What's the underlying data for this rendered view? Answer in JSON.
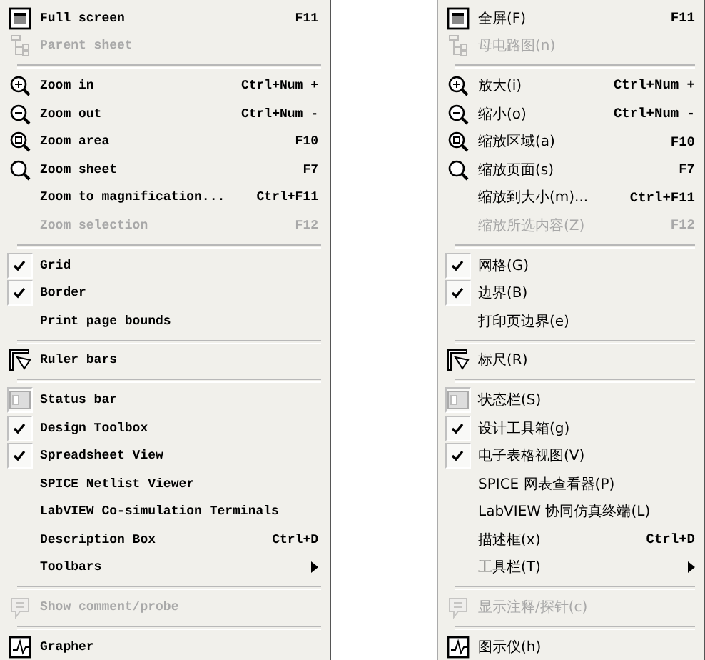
{
  "menus": [
    {
      "items": [
        {
          "kind": "item",
          "label": "Full screen",
          "shortcut": "F11",
          "checked": false,
          "disabled": false,
          "submenu": false
        },
        {
          "kind": "item",
          "label": "Parent sheet",
          "checked": false,
          "disabled": true,
          "submenu": false
        },
        {
          "kind": "separator"
        },
        {
          "kind": "item",
          "label": "Zoom in",
          "shortcut": "Ctrl+Num +",
          "checked": false,
          "disabled": false,
          "submenu": false
        },
        {
          "kind": "item",
          "label": "Zoom out",
          "shortcut": "Ctrl+Num -",
          "checked": false,
          "disabled": false,
          "submenu": false
        },
        {
          "kind": "item",
          "label": "Zoom area",
          "shortcut": "F10",
          "checked": false,
          "disabled": false,
          "submenu": false
        },
        {
          "kind": "item",
          "label": "Zoom sheet",
          "shortcut": "F7",
          "checked": false,
          "disabled": false,
          "submenu": false
        },
        {
          "kind": "item",
          "label": "Zoom to magnification...",
          "shortcut": "Ctrl+F11",
          "checked": false,
          "disabled": false,
          "submenu": false
        },
        {
          "kind": "item",
          "label": "Zoom selection",
          "shortcut": "F12",
          "checked": false,
          "disabled": true,
          "submenu": false
        },
        {
          "kind": "separator"
        },
        {
          "kind": "item",
          "label": "Grid",
          "checked": true,
          "disabled": false,
          "submenu": false
        },
        {
          "kind": "item",
          "label": "Border",
          "checked": true,
          "disabled": false,
          "submenu": false
        },
        {
          "kind": "item",
          "label": "Print page bounds",
          "checked": false,
          "disabled": false,
          "submenu": false
        },
        {
          "kind": "separator"
        },
        {
          "kind": "item",
          "label": "Ruler bars",
          "checked": false,
          "disabled": false,
          "submenu": false
        },
        {
          "kind": "separator"
        },
        {
          "kind": "item",
          "label": "Status bar",
          "checked": true,
          "disabled": false,
          "submenu": false
        },
        {
          "kind": "item",
          "label": "Design Toolbox",
          "checked": true,
          "disabled": false,
          "submenu": false
        },
        {
          "kind": "item",
          "label": "Spreadsheet View",
          "checked": true,
          "disabled": false,
          "submenu": false
        },
        {
          "kind": "item",
          "label": "SPICE Netlist Viewer",
          "checked": false,
          "disabled": false,
          "submenu": false
        },
        {
          "kind": "item",
          "label": "LabVIEW Co-simulation Terminals",
          "checked": false,
          "disabled": false,
          "submenu": false
        },
        {
          "kind": "item",
          "label": "Description Box",
          "shortcut": "Ctrl+D",
          "checked": false,
          "disabled": false,
          "submenu": false
        },
        {
          "kind": "item",
          "label": "Toolbars",
          "checked": false,
          "disabled": false,
          "submenu": true
        },
        {
          "kind": "separator"
        },
        {
          "kind": "item",
          "label": "Show comment/probe",
          "checked": false,
          "disabled": true,
          "submenu": false
        },
        {
          "kind": "separator"
        },
        {
          "kind": "item",
          "label": "Grapher",
          "checked": false,
          "disabled": false,
          "submenu": false
        }
      ]
    },
    {
      "items": [
        {
          "kind": "item",
          "label": "全屏(F)",
          "shortcut": "F11",
          "checked": false,
          "disabled": false,
          "submenu": false
        },
        {
          "kind": "item",
          "label": "母电路图(n)",
          "checked": false,
          "disabled": true,
          "submenu": false
        },
        {
          "kind": "separator"
        },
        {
          "kind": "item",
          "label": "放大(i)",
          "shortcut": "Ctrl+Num +",
          "checked": false,
          "disabled": false,
          "submenu": false
        },
        {
          "kind": "item",
          "label": "缩小(o)",
          "shortcut": "Ctrl+Num -",
          "checked": false,
          "disabled": false,
          "submenu": false
        },
        {
          "kind": "item",
          "label": "缩放区域(a)",
          "shortcut": "F10",
          "checked": false,
          "disabled": false,
          "submenu": false
        },
        {
          "kind": "item",
          "label": "缩放页面(s)",
          "shortcut": "F7",
          "checked": false,
          "disabled": false,
          "submenu": false
        },
        {
          "kind": "item",
          "label": "缩放到大小(m)...",
          "shortcut": "Ctrl+F11",
          "checked": false,
          "disabled": false,
          "submenu": false
        },
        {
          "kind": "item",
          "label": "缩放所选内容(Z)",
          "shortcut": "F12",
          "checked": false,
          "disabled": true,
          "submenu": false
        },
        {
          "kind": "separator"
        },
        {
          "kind": "item",
          "label": "网格(G)",
          "checked": true,
          "disabled": false,
          "submenu": false
        },
        {
          "kind": "item",
          "label": "边界(B)",
          "checked": true,
          "disabled": false,
          "submenu": false
        },
        {
          "kind": "item",
          "label": "打印页边界(e)",
          "checked": false,
          "disabled": false,
          "submenu": false
        },
        {
          "kind": "separator"
        },
        {
          "kind": "item",
          "label": "标尺(R)",
          "checked": false,
          "disabled": false,
          "submenu": false
        },
        {
          "kind": "separator"
        },
        {
          "kind": "item",
          "label": "状态栏(S)",
          "checked": true,
          "disabled": false,
          "submenu": false
        },
        {
          "kind": "item",
          "label": "设计工具箱(g)",
          "checked": true,
          "disabled": false,
          "submenu": false
        },
        {
          "kind": "item",
          "label": "电子表格视图(V)",
          "checked": true,
          "disabled": false,
          "submenu": false
        },
        {
          "kind": "item",
          "label": "SPICE 网表查看器(P)",
          "checked": false,
          "disabled": false,
          "submenu": false
        },
        {
          "kind": "item",
          "label": "LabVIEW 协同仿真终端(L)",
          "checked": false,
          "disabled": false,
          "submenu": false
        },
        {
          "kind": "item",
          "label": "描述框(x)",
          "shortcut": "Ctrl+D",
          "checked": false,
          "disabled": false,
          "submenu": false
        },
        {
          "kind": "item",
          "label": "工具栏(T)",
          "checked": false,
          "disabled": false,
          "submenu": true
        },
        {
          "kind": "separator"
        },
        {
          "kind": "item",
          "label": "显示注释/探针(c)",
          "checked": false,
          "disabled": true,
          "submenu": false
        },
        {
          "kind": "separator"
        },
        {
          "kind": "item",
          "label": "图示仪(h)",
          "checked": false,
          "disabled": false,
          "submenu": false
        }
      ]
    }
  ]
}
